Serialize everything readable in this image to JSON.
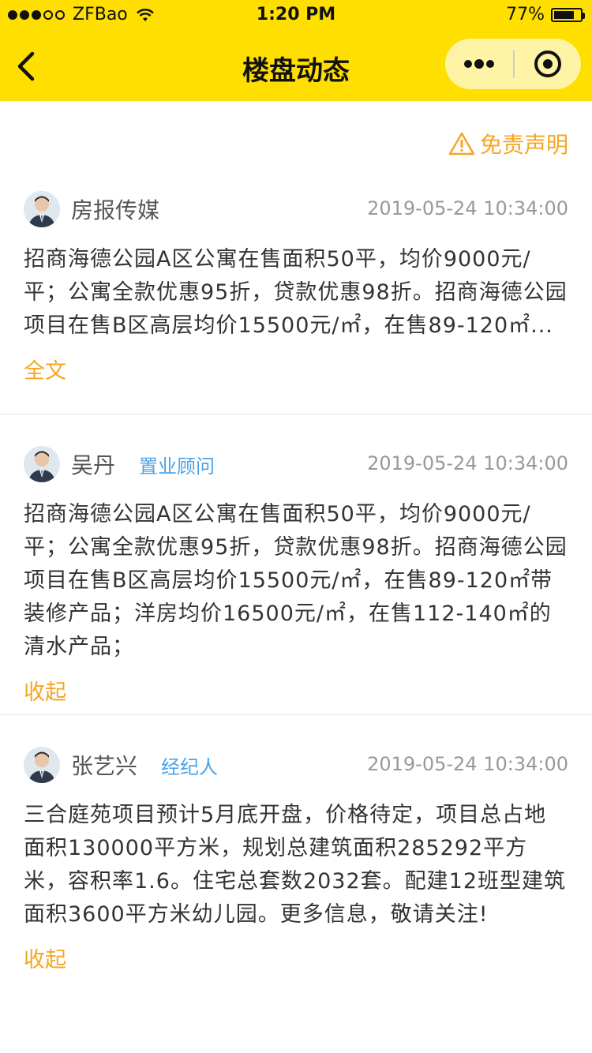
{
  "status_bar": {
    "carrier": "ZFBao",
    "time": "1:20 PM",
    "battery_percent_text": "77%",
    "battery_level": 0.77
  },
  "nav": {
    "title": "楼盘动态",
    "back_icon": "chevron-left-icon",
    "more_icon": "more-dots-icon",
    "close_icon": "target-close-icon"
  },
  "disclaimer": {
    "label": "免责声明",
    "icon": "warning-triangle-icon",
    "color": "#f5a623"
  },
  "colors": {
    "brand_yellow": "#ffdf00",
    "accent_orange": "#f5a623",
    "role_blue": "#4aa3e8"
  },
  "posts": [
    {
      "author": "房报传媒",
      "role": "",
      "time": "2019-05-24 10:34:00",
      "content": "招商海德公园A区公寓在售面积50平，均价9000元/平；公寓全款优惠95折，贷款优惠98折。招商海德公园项目在售B区高层均价15500元/㎡，在售89-120㎡...",
      "toggle": "全文"
    },
    {
      "author": "吴丹",
      "role": "置业顾问",
      "time": "2019-05-24 10:34:00",
      "content": "招商海德公园A区公寓在售面积50平，均价9000元/平；公寓全款优惠95折，贷款优惠98折。招商海德公园项目在售B区高层均价15500元/㎡，在售89-120㎡带装修产品；洋房均价16500元/㎡，在售112-140㎡的清水产品；",
      "toggle": "收起"
    },
    {
      "author": "张艺兴",
      "role": "经纪人",
      "time": "2019-05-24 10:34:00",
      "content": "三合庭苑项目预计5月底开盘，价格待定，项目总占地面积130000平方米，规划总建筑面积285292平方米，容积率1.6。住宅总套数2032套。配建12班型建筑面积3600平方米幼儿园。更多信息，敬请关注!",
      "toggle": "收起"
    }
  ]
}
